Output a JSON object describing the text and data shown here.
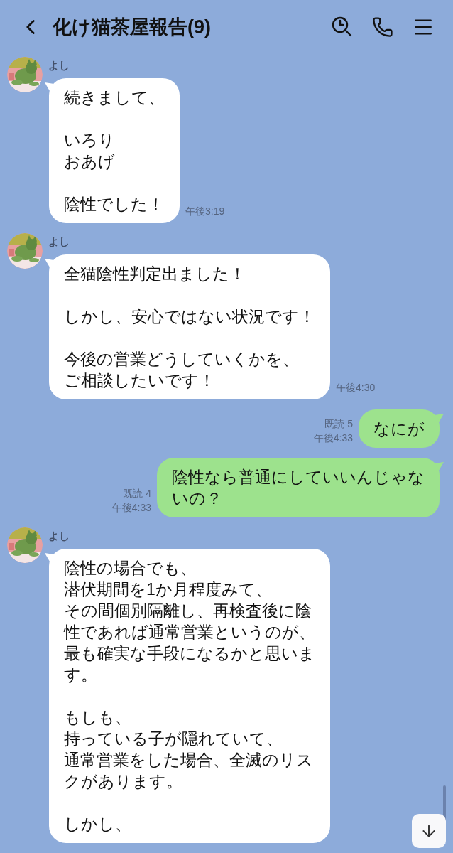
{
  "header": {
    "title": "化け猫茶屋報告(9)"
  },
  "messages": [
    {
      "kind": "incoming",
      "sender": "よし",
      "paragraphs": [
        [
          "続きまして、"
        ],
        [
          "いろり",
          "おあげ"
        ],
        [
          "陰性でした！"
        ]
      ],
      "time": "午後3:19"
    },
    {
      "kind": "incoming",
      "sender": "よし",
      "paragraphs": [
        [
          "全猫陰性判定出ました！"
        ],
        [
          "しかし、安心ではない状況です！"
        ],
        [
          "今後の営業どうしていくかを、",
          "ご相談したいです！"
        ]
      ],
      "time": "午後4:30"
    },
    {
      "kind": "outgoing",
      "read": "既読 5",
      "time": "午後4:33",
      "paragraphs": [
        [
          "なにが"
        ]
      ]
    },
    {
      "kind": "outgoing",
      "read": "既読 4",
      "time": "午後4:33",
      "paragraphs": [
        [
          "陰性なら普通にしていいんじゃな",
          "いの？"
        ]
      ]
    },
    {
      "kind": "incoming",
      "sender": "よし",
      "paragraphs": [
        [
          "陰性の場合でも、",
          "潜伏期間を1か月程度みて、",
          "その間個別隔離し、再検査後に陰",
          "性であれば通常営業というのが、",
          "最も確実な手段になるかと思いま",
          "す。"
        ],
        [
          "もしも、",
          "持っている子が隠れていて、",
          "通常営業をした場合、全滅のリス",
          "クがあります。"
        ],
        [
          "しかし、"
        ]
      ]
    }
  ]
}
